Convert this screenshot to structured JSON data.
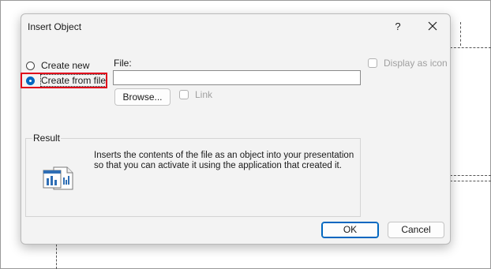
{
  "dialog": {
    "title": "Insert Object",
    "help_label": "?",
    "options": {
      "create_new_label": "Create new",
      "create_from_file_label": "Create from file",
      "selected": "Create from file"
    },
    "file": {
      "label": "File:",
      "value": "",
      "browse_label": "Browse...",
      "link_label": "Link",
      "link_checked": false
    },
    "display_as_icon": {
      "label": "Display as icon",
      "checked": false
    },
    "result": {
      "title": "Result",
      "text": "Inserts the contents of the file as an object into your presentation so that you can activate it using the application that created it.",
      "icon": "embedded-file-icon"
    },
    "ok_label": "OK",
    "cancel_label": "Cancel"
  },
  "colors": {
    "accent": "#0067c0",
    "highlight_annotation": "#e0001b"
  }
}
